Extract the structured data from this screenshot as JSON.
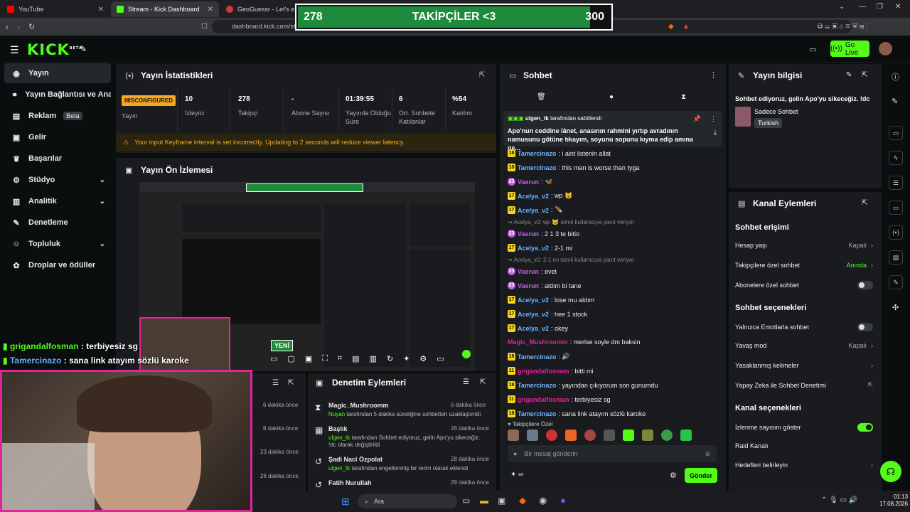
{
  "browser": {
    "tabs": [
      {
        "label": "YouTube",
        "active": false
      },
      {
        "label": "Stream - Kick Dashboard",
        "active": true
      },
      {
        "label": "GeoGuessr - Let's expl",
        "active": false
      }
    ],
    "url": "dashboard.kick.com/str"
  },
  "follower_goal": {
    "current": "278",
    "label": "TAKİPÇİLER <3",
    "target": "300",
    "progress": 0.927
  },
  "header": {
    "logo": "KICK",
    "logo_sup": "BETA",
    "go_live": "Go Live"
  },
  "sidebar": {
    "items": [
      {
        "label": "Yayın",
        "icon": "broadcast-icon",
        "active": true
      },
      {
        "label": "Yayın Bağlantısı ve Anahtarı",
        "icon": "link-icon"
      },
      {
        "label": "Reklam",
        "badge": "Beta",
        "icon": "ad-icon"
      },
      {
        "label": "Gelir",
        "icon": "money-icon"
      },
      {
        "label": "Başarılar",
        "icon": "trophy-icon"
      },
      {
        "label": "Stüdyo",
        "icon": "studio-icon",
        "chevron": true
      },
      {
        "label": "Analitik",
        "icon": "chart-icon",
        "chevron": true
      },
      {
        "label": "Denetleme",
        "icon": "wrench-icon"
      },
      {
        "label": "Topluluk",
        "icon": "people-icon",
        "chevron": true
      },
      {
        "label": "Droplar ve ödüller",
        "icon": "gift-icon"
      }
    ]
  },
  "stats": {
    "title": "Yayın İstatistikleri",
    "status_badge": "MISCONFIGURED",
    "items": [
      {
        "value": "",
        "label": "Yayın"
      },
      {
        "value": "10",
        "label": "İzleyici"
      },
      {
        "value": "278",
        "label": "Takipçi"
      },
      {
        "value": "-",
        "label": "Abone Sayısı"
      },
      {
        "value": "01:39:55",
        "label": "Yayında Olduğu Süre"
      },
      {
        "value": "6",
        "label": "Ort. Sohbete Katılanlar"
      },
      {
        "value": "%54",
        "label": "Katılım"
      }
    ],
    "warning": "Your input Keyframe interval is set incorrectly. Updating to 2 seconds will reduce viewer latency."
  },
  "preview": {
    "title": "Yayın Ön İzlemesi",
    "new_badge": "YENİ"
  },
  "overlay_chat": [
    {
      "user": "grigandalfosman",
      "text": " : terbiyesiz sg",
      "color": "#53fc18"
    },
    {
      "user": "Tamercinazo",
      "text": " : sana link atayım sözlü karoke",
      "color": "#6cb4ff"
    }
  ],
  "activity": {
    "times": [
      "6 dakika önce",
      "8 dakika önce",
      "23 dakika önce",
      "26 dakika önce"
    ]
  },
  "moderation": {
    "title": "Denetim Eylemleri",
    "items": [
      {
        "title": "Magic_Mushroomm",
        "time": "6 dakika önce",
        "user": "Nuyan",
        "desc": " tarafından 5 dakika süreliğine sohbetten uzaklaştırıldı",
        "icon": "hourglass-icon"
      },
      {
        "title": "Başlık",
        "time": "26 dakika önce",
        "user": "ulgen_tk",
        "desc": " tarafından Sohbet ediyoruz, gelin Apo'yu sikeceğiz. !dc olarak değiştirildi",
        "icon": "title-icon"
      },
      {
        "title": "Şadi Naci Özpolat",
        "time": "28 dakika önce",
        "user": "ulgen_tk",
        "desc": " tarafından engellenmiş bir terim olarak eklendi",
        "icon": "undo-icon"
      },
      {
        "title": "Fatih Nurullah",
        "time": "29 dakika önce",
        "user": "",
        "desc": "",
        "icon": "undo-icon"
      }
    ]
  },
  "chat": {
    "title": "Sohbet",
    "pinned_by": "ulgen_tk",
    "pinned_suffix": "tarafından sabitlendi",
    "pinned_text": "Apo'nun ceddine lânet, anasının rahmini yırtıp avradının namusunu götüne tıkayım, soyunu sopunu kıyma edip amına ge...",
    "messages": [
      {
        "badge": "18",
        "user": "Tamercinazo",
        "color": "#6cb4ff",
        "text": ": i aint listenin allat"
      },
      {
        "badge": "18",
        "user": "Tamercinazo",
        "color": "#6cb4ff",
        "text": ": this man is worse than tyga"
      },
      {
        "badge": "23",
        "user": "Vaerun",
        "color": "#c45ce0",
        "text": ": 🦋"
      },
      {
        "badge": "17",
        "user": "Acelya_v2",
        "color": "#6cb4ff",
        "text": ": wp 🐱"
      },
      {
        "badge": "17",
        "user": "Acelya_v2",
        "color": "#6cb4ff",
        "text": ": 🪶"
      },
      {
        "reply": "↪ Acelya_v2: wp 🐱 isimli kullanıcıya yanıt veriyor"
      },
      {
        "badge": "23",
        "user": "Vaerun",
        "color": "#c45ce0",
        "text": ": 2 1 3 te bitio"
      },
      {
        "badge": "17",
        "user": "Acelya_v2",
        "color": "#6cb4ff",
        "text": ": 2-1 mi"
      },
      {
        "reply": "↪ Acelya_v2: 2-1 mi isimli kullanıcıya yanıt veriyor"
      },
      {
        "badge": "23",
        "user": "Vaerun",
        "color": "#c45ce0",
        "text": ": evet"
      },
      {
        "badge": "23",
        "user": "Vaerun",
        "color": "#c45ce0",
        "text": ": aldım bi tane"
      },
      {
        "badge": "17",
        "user": "Acelya_v2",
        "color": "#6cb4ff",
        "text": ": lose mu aldım"
      },
      {
        "badge": "17",
        "user": "Acelya_v2",
        "color": "#6cb4ff",
        "text": ": hee 1 stock"
      },
      {
        "badge": "17",
        "user": "Acelya_v2",
        "color": "#6cb4ff",
        "text": ": okey"
      },
      {
        "badge": "",
        "user": "Magic_Mushroomm",
        "color": "#e0249a",
        "text": ": merlse soyle dm baksin"
      },
      {
        "badge": "18",
        "user": "Tamercinazo",
        "color": "#6cb4ff",
        "text": ": 🔊"
      },
      {
        "badge": "11",
        "user": "grigandalfosman",
        "color": "#e0249a",
        "text": ": bitti mi"
      },
      {
        "badge": "18",
        "user": "Tamercinazo",
        "color": "#6cb4ff",
        "text": ": yayından çıkıyorum son gunumdu"
      },
      {
        "badge": "11",
        "user": "grigandalfosman",
        "color": "#e0249a",
        "text": ": terbiyesiz sg"
      },
      {
        "badge": "18",
        "user": "Tamercinazo",
        "color": "#6cb4ff",
        "text": ": sana link atayım sözlü karoke"
      }
    ],
    "followers_only": "Takipçilere Özel",
    "input_placeholder": "Bir mesaj gönderin",
    "send": "Gönder"
  },
  "stream_info": {
    "title": "Yayın bilgisi",
    "stream_title": "Sohbet ediyoruz, gelin Apo'yu sikeceğiz. !dc",
    "category": "Sadece Sohbet",
    "language": "Turkish"
  },
  "channel_actions": {
    "title": "Kanal Eylemleri",
    "chat_access": "Sohbet erişimi",
    "account_age": {
      "label": "Hesap yaşı",
      "value": "Kapalı"
    },
    "followers_chat": {
      "label": "Takipçilere özel sohbet",
      "value": "Anında"
    },
    "subs_chat": {
      "label": "Abonelere özel sohbet"
    },
    "chat_options": "Sohbet seçenekleri",
    "emote_only": {
      "label": "Yalnızca Emotlarla sohbet"
    },
    "slow_mode": {
      "label": "Yavaş mod",
      "value": "Kapalı"
    },
    "banned_words": {
      "label": "Yasaklanmış kelimeler"
    },
    "ai_mod": {
      "label": "Yapay Zeka ile Sohbet Denetimi"
    },
    "channel_options": "Kanal seçenekleri",
    "show_viewers": {
      "label": "İzlenme sayısını göster"
    },
    "raid": {
      "label": "Raid Kanalı"
    },
    "goals": {
      "label": "Hedefleri belirleyin"
    }
  },
  "taskbar": {
    "search": "Ara",
    "time": "01:13",
    "date": "17.08.2026"
  },
  "colors": {
    "accent": "#53fc18",
    "bg": "#0b0e0f",
    "panel": "#191b1f",
    "warning": "#f7a81b",
    "webcam_border": "#e0249a"
  }
}
